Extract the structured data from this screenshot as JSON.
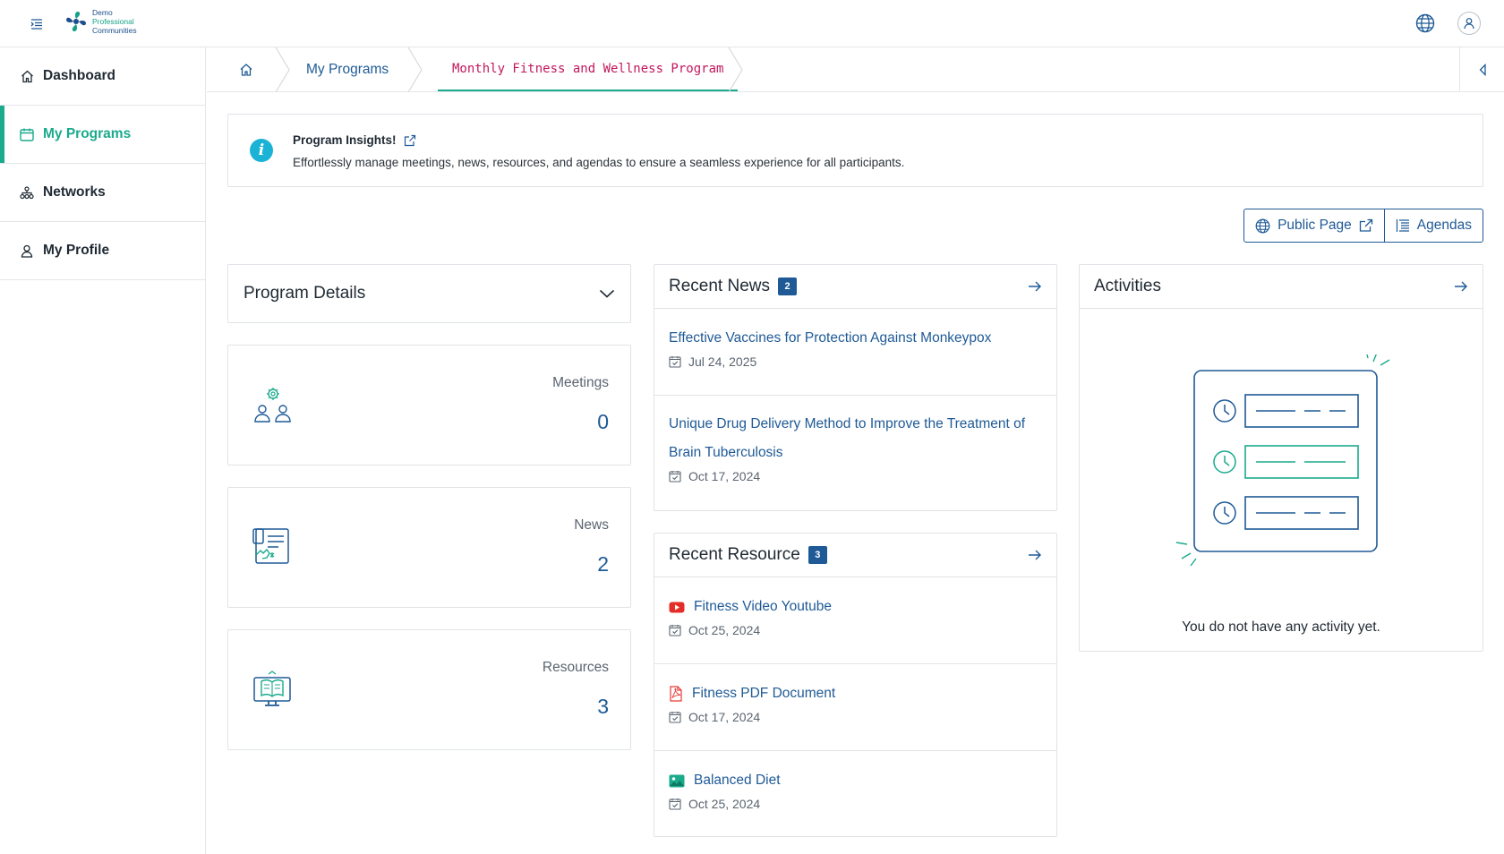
{
  "header": {
    "logo": {
      "line1": "Demo",
      "line2": "Professional",
      "line3": "Communities"
    }
  },
  "sidebar": {
    "items": [
      {
        "label": "Dashboard",
        "icon": "home-icon"
      },
      {
        "label": "My Programs",
        "icon": "calendar-icon",
        "active": true
      },
      {
        "label": "Networks",
        "icon": "network-icon"
      },
      {
        "label": "My Profile",
        "icon": "user-icon"
      }
    ]
  },
  "breadcrumb": {
    "programs": "My Programs",
    "current": "Monthly Fitness and Wellness Program"
  },
  "insight": {
    "title": "Program Insights!",
    "text": "Effortlessly manage meetings, news, resources, and agendas to ensure a seamless experience for all participants."
  },
  "actions": {
    "public_page": "Public Page",
    "agendas": "Agendas"
  },
  "program_details": {
    "title": "Program Details"
  },
  "stats": [
    {
      "label": "Meetings",
      "value": "0",
      "icon": "meetings-icon"
    },
    {
      "label": "News",
      "value": "2",
      "icon": "news-icon"
    },
    {
      "label": "Resources",
      "value": "3",
      "icon": "resources-icon"
    }
  ],
  "recent_news": {
    "title": "Recent News",
    "count": "2",
    "items": [
      {
        "title": "Effective Vaccines for Protection Against Monkeypox",
        "date": "Jul 24, 2025"
      },
      {
        "title_line1": "Unique Drug Delivery Method to Improve the Treatment of",
        "title_line2": "Brain Tuberculosis",
        "date": "Oct 17, 2024"
      }
    ]
  },
  "recent_resource": {
    "title": "Recent Resource",
    "count": "3",
    "items": [
      {
        "title": "Fitness Video Youtube",
        "date": "Oct 25, 2024",
        "icon": "youtube-icon"
      },
      {
        "title": "Fitness PDF Document",
        "date": "Oct 17, 2024",
        "icon": "pdf-icon"
      },
      {
        "title": "Balanced Diet",
        "date": "Oct 25, 2024",
        "icon": "image-icon"
      }
    ]
  },
  "activities": {
    "title": "Activities",
    "empty_text": "You do not have any activity yet."
  },
  "colors": {
    "accent": "#1aaa8c",
    "link": "#1f5a96",
    "current_crumb": "#c2185b",
    "info": "#1ab3d6"
  }
}
